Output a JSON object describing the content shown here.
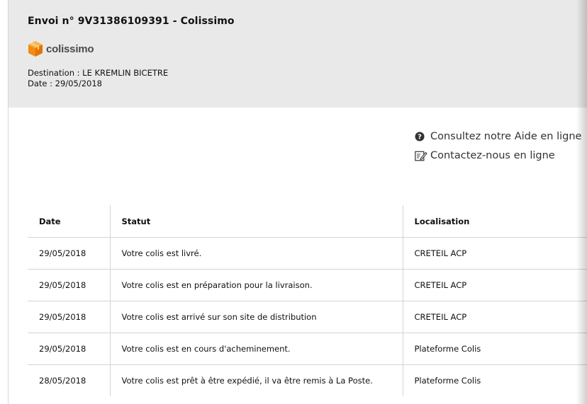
{
  "header": {
    "title": "Envoi n° 9V31386109391 - Colissimo",
    "brand": {
      "name": "colissimo",
      "icon": "colissimo-box-logo",
      "color": "#f49a1a"
    },
    "destination": "Destination : LE KREMLIN BICETRE",
    "date": "Date : 29/05/2018"
  },
  "links": [
    {
      "label": "Consultez notre Aide en ligne",
      "icon": "question-circle-icon"
    },
    {
      "label": "Contactez-nous en ligne",
      "icon": "edit-form-icon"
    }
  ],
  "table": {
    "columns": [
      "Date",
      "Statut",
      "Localisation"
    ],
    "rows": [
      {
        "date": "29/05/2018",
        "status": "Votre colis est livré.",
        "location": "CRETEIL ACP"
      },
      {
        "date": "29/05/2018",
        "status": "Votre colis est en préparation pour la livraison.",
        "location": "CRETEIL ACP"
      },
      {
        "date": "29/05/2018",
        "status": "Votre colis est arrivé sur son site de distribution",
        "location": "CRETEIL ACP"
      },
      {
        "date": "29/05/2018",
        "status": "Votre colis est en cours d'acheminement.",
        "location": "Plateforme Colis"
      },
      {
        "date": "28/05/2018",
        "status": "Votre colis est prêt à être expédié, il va être remis à La Poste.",
        "location": "Plateforme Colis"
      }
    ]
  },
  "colors": {
    "header_bg": "#e9e9e9",
    "border": "#d4d4d4",
    "text": "#111111"
  }
}
